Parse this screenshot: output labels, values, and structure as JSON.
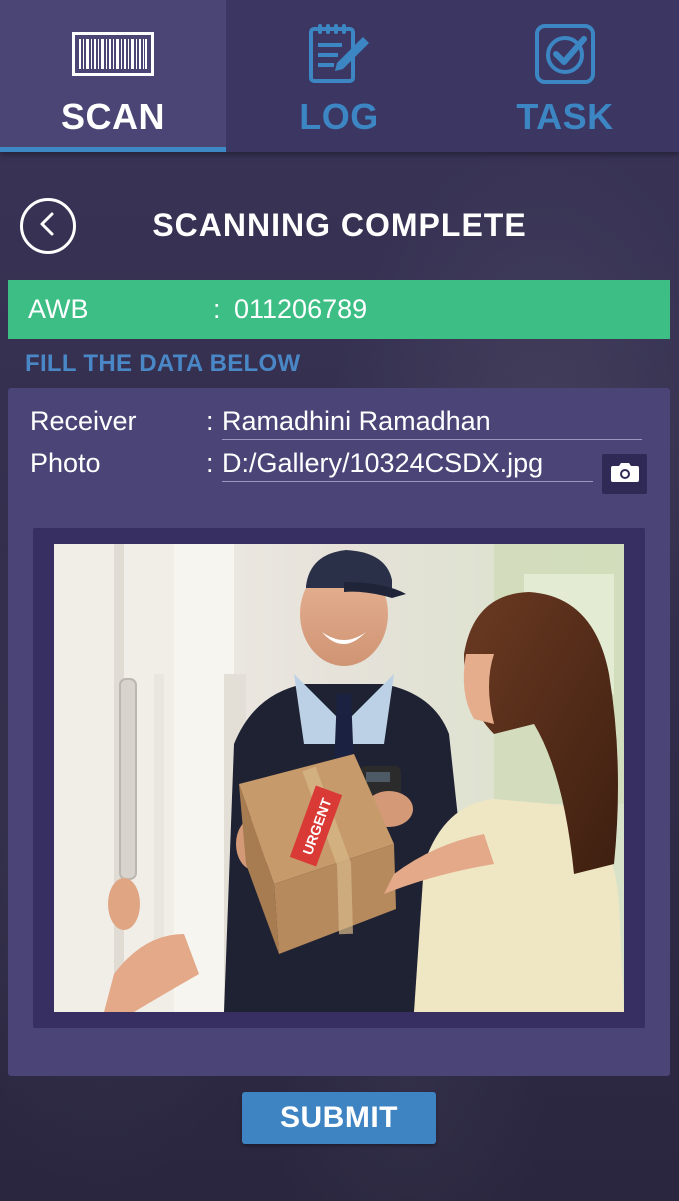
{
  "tabs": [
    {
      "label": "SCAN",
      "icon": "barcode-icon",
      "active": true
    },
    {
      "label": "LOG",
      "icon": "notepad-pencil-icon",
      "active": false
    },
    {
      "label": "TASK",
      "icon": "checkbox-icon",
      "active": false
    }
  ],
  "header": {
    "title": "SCANNING COMPLETE",
    "back_icon": "chevron-left-icon"
  },
  "awb": {
    "label": "AWB",
    "separator": ":",
    "value": "011206789"
  },
  "fill_heading": "FILL THE DATA BELOW",
  "form": {
    "receiver": {
      "label": "Receiver",
      "separator": ":",
      "value": "Ramadhini Ramadhan"
    },
    "photo": {
      "label": "Photo",
      "separator": ":",
      "value": "D:/Gallery/10324CSDX.jpg",
      "button_icon": "camera-icon"
    }
  },
  "photo_preview": {
    "parcel_label": "URGENT"
  },
  "submit_label": "SUBMIT",
  "colors": {
    "tab_bar": "#3b3662",
    "tab_active": "#4a4575",
    "accent_blue": "#3d86c4",
    "awb_green": "#3dbe85",
    "card": "#4b4477",
    "photo_frame": "#372f62"
  }
}
